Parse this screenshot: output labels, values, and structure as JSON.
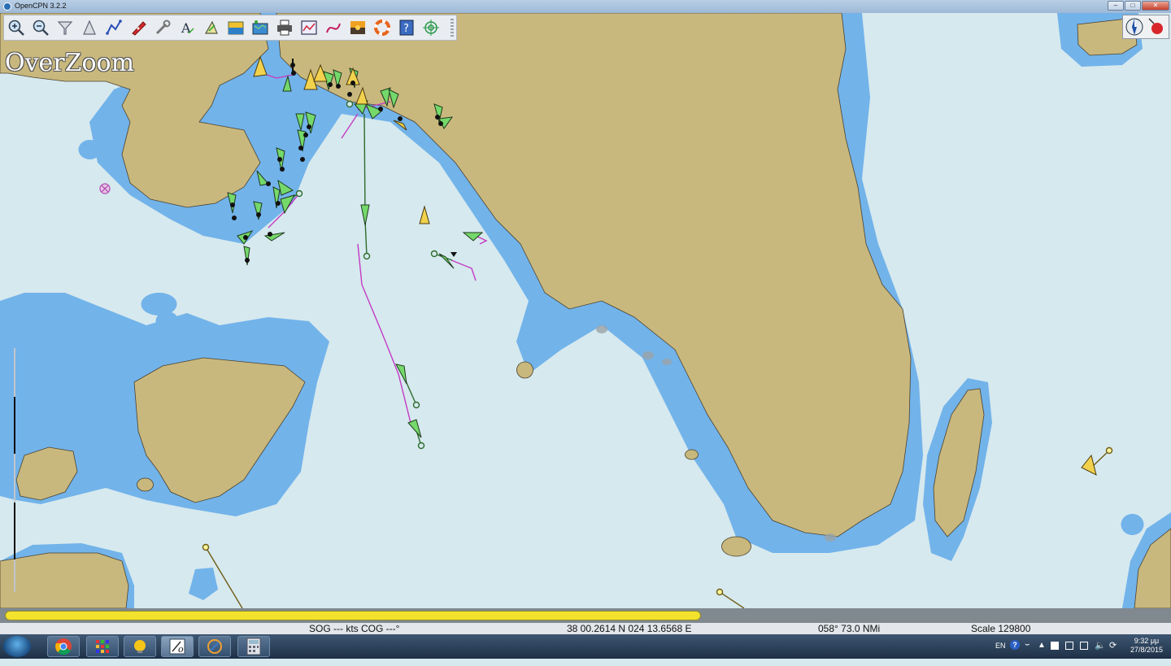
{
  "window": {
    "title": "OpenCPN 3.2.2",
    "controls": [
      "minimize",
      "maximize",
      "close"
    ]
  },
  "toolbar": {
    "tools": [
      {
        "name": "zoom-in",
        "icon": "magnifier-plus-icon"
      },
      {
        "name": "zoom-out",
        "icon": "magnifier-minus-icon"
      },
      {
        "name": "scale-in",
        "icon": "funnel-icon"
      },
      {
        "name": "scale-out",
        "icon": "cone-icon"
      },
      {
        "name": "create-route",
        "icon": "route-icon"
      },
      {
        "name": "auto-follow",
        "icon": "boat-icon"
      },
      {
        "name": "options",
        "icon": "wrench-icon"
      },
      {
        "name": "text",
        "icon": "text-a-icon"
      },
      {
        "name": "current",
        "icon": "current-arrow-icon"
      },
      {
        "name": "tide",
        "icon": "tide-icon"
      },
      {
        "name": "quilting",
        "icon": "chart-stack-icon"
      },
      {
        "name": "print",
        "icon": "printer-icon"
      },
      {
        "name": "route-manager",
        "icon": "route-manager-icon"
      },
      {
        "name": "track",
        "icon": "track-icon"
      },
      {
        "name": "color-scheme",
        "icon": "sunset-icon"
      },
      {
        "name": "mob",
        "icon": "lifebuoy-icon"
      },
      {
        "name": "about",
        "icon": "help-icon"
      },
      {
        "name": "plugin",
        "icon": "crosshair-icon"
      }
    ]
  },
  "chart": {
    "overlay_text": "OverZoom"
  },
  "status": {
    "sog_cog": "SOG --- kts  COG ---°",
    "position": "38 00.2614 N   024 13.6568 E",
    "bearing_distance": "058°  73.0 NMi",
    "scale": "Scale 129800"
  },
  "taskbar": {
    "language": "EN",
    "time": "9:32 μμ",
    "date": "27/8/2015"
  },
  "colors": {
    "sea_deep": "#d6e9ee",
    "sea_shallow": "#72b3ea",
    "land": "#c9b87d",
    "ais_moving": "#74d96a",
    "ais_anchored": "#f2d24d",
    "track": "#c43bc4",
    "piano_bar": "#f2e22e"
  }
}
